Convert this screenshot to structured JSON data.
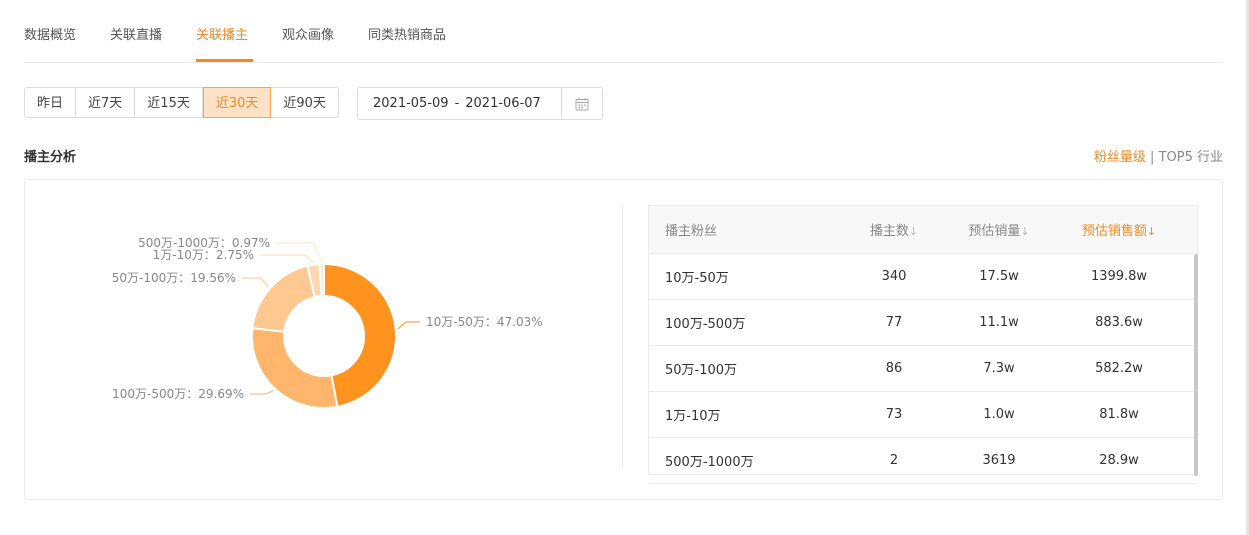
{
  "tabs": [
    {
      "label": "数据概览"
    },
    {
      "label": "关联直播"
    },
    {
      "label": "关联播主"
    },
    {
      "label": "观众画像"
    },
    {
      "label": "同类热销商品"
    }
  ],
  "active_tab": "关联播主",
  "ranges": [
    {
      "label": "昨日"
    },
    {
      "label": "近7天"
    },
    {
      "label": "近15天"
    },
    {
      "label": "近30天"
    },
    {
      "label": "近90天"
    }
  ],
  "active_range": "近30天",
  "date_range": {
    "start": "2021-05-09",
    "sep": "-",
    "end": "2021-06-07"
  },
  "section": {
    "title": "播主分析",
    "link1": "粉丝量级",
    "divider": "|",
    "link2": "TOP5 行业"
  },
  "chart_data": {
    "type": "pie",
    "labels": [
      "10万-50万",
      "100万-500万",
      "50万-100万",
      "1万-10万",
      "500万-1000万"
    ],
    "values": [
      47.03,
      29.69,
      19.56,
      2.75,
      0.97
    ],
    "unit": "%",
    "colors": [
      "#ff931e",
      "#ffb56b",
      "#ffc891",
      "#ffd8b0",
      "#ffe6cc"
    ]
  },
  "table": {
    "headers": [
      "播主粉丝",
      "播主数",
      "预估销量",
      "预估销售额"
    ],
    "sort_icon": "↓",
    "rows": [
      [
        "10万-50万",
        "340",
        "17.5w",
        "1399.8w"
      ],
      [
        "100万-500万",
        "77",
        "11.1w",
        "883.6w"
      ],
      [
        "50万-100万",
        "86",
        "7.3w",
        "582.2w"
      ],
      [
        "1万-10万",
        "73",
        "1.0w",
        "81.8w"
      ],
      [
        "500万-1000万",
        "2",
        "3619",
        "28.9w"
      ]
    ]
  },
  "icons": {
    "calendar": "calendar-icon",
    "sort": "sort-desc-icon"
  }
}
